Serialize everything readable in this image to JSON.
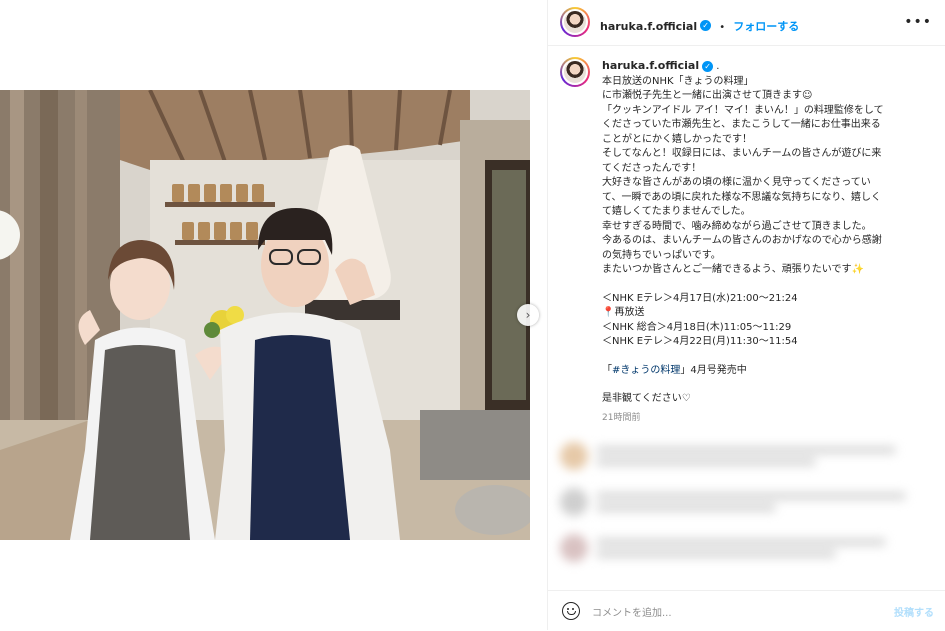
{
  "post": {
    "username": "haruka.f.official",
    "follow_label": "フォローする",
    "separator": "•",
    "caption_suffix": ".",
    "caption_lines": [
      "本日放送のNHK「きょうの料理」",
      "に市瀬悦子先生と一緒に出演させて頂きます☺",
      "「クッキンアイドル アイ！マイ！まいん！」の料理監修をして",
      "くださっていた市瀬先生と、またこうして一緒にお仕事出来る",
      "ことがとにかく嬉しかったです！",
      "そしてなんと！収録日には、まいんチームの皆さんが遊びに来",
      "てくださったんです！",
      "大好きな皆さんがあの頃の様に温かく見守ってくださってい",
      "て、一瞬であの頃に戻れた様な不思議な気持ちになり、嬉しく",
      "て嬉しくてたまりませんでした。",
      "幸せすぎる時間で、噛み締めながら過ごさせて頂きました。",
      "今あるのは、まいんチームの皆さんのおかげなので心から感謝",
      "の気持ちでいっぱいです。",
      "またいつか皆さんとご一緒できるよう、頑張りたいです✨"
    ],
    "schedule_lines": [
      "＜NHK Eテレ＞4月17日(水)21:00～21:24",
      "📍再放送",
      "＜NHK 総合＞4月18日(木)11:05～11:29",
      "＜NHK Eテレ＞4月22日(月)11:30～11:54"
    ],
    "magazine_prefix": "「",
    "hashtag": "#きょうの料理",
    "magazine_suffix": "」4月号発売中",
    "closing": "是非観てください♡",
    "timestamp": "21時間前"
  },
  "comment_box": {
    "placeholder": "コメントを追加...",
    "post_label": "投稿する"
  },
  "icons": {
    "more": "more-options-icon",
    "emoji": "emoji-icon",
    "verified": "verified-badge-icon",
    "carousel_next": "chevron-right-icon"
  },
  "colors": {
    "accent": "#0095f6",
    "hashtag": "#00376b",
    "muted": "#8e8e8e"
  }
}
